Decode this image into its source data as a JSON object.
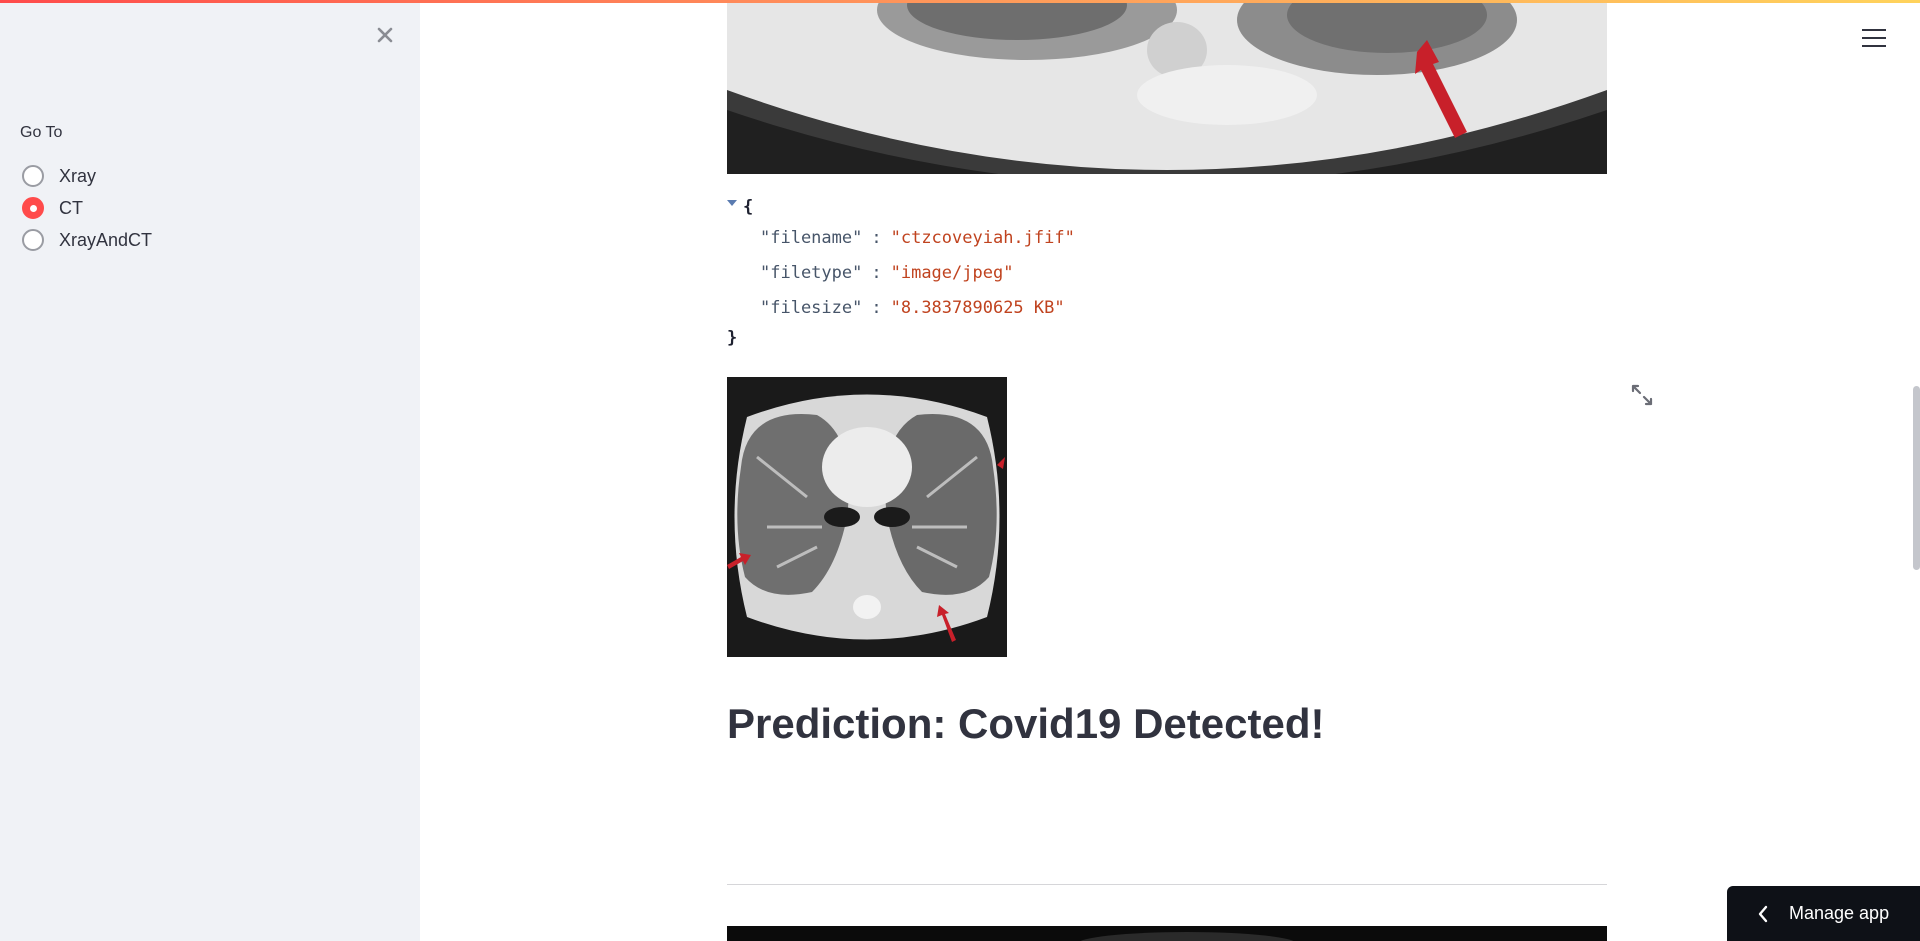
{
  "sidebar": {
    "close_icon": "close-icon",
    "label": "Go To",
    "options": [
      {
        "label": "Xray",
        "selected": false
      },
      {
        "label": "CT",
        "selected": true
      },
      {
        "label": "XrayAndCT",
        "selected": false
      }
    ]
  },
  "header": {
    "menu_icon": "hamburger-menu-icon"
  },
  "file_info": {
    "open_brace": "{",
    "close_brace": "}",
    "entries": [
      {
        "key": "\"filename\"",
        "colon": ":",
        "value": "\"ctzcoveyiah.jfif\""
      },
      {
        "key": "\"filetype\"",
        "colon": ":",
        "value": "\"image/jpeg\""
      },
      {
        "key": "\"filesize\"",
        "colon": ":",
        "value": "\"8.3837890625 KB\""
      }
    ]
  },
  "prediction": {
    "text": "Prediction: Covid19 Detected!"
  },
  "manage_app": {
    "label": "Manage app"
  },
  "colors": {
    "accent": "#ff4b4b",
    "sidebar_bg": "#f0f2f6",
    "json_value": "#c0431f",
    "manage_bg": "#0e1117"
  }
}
